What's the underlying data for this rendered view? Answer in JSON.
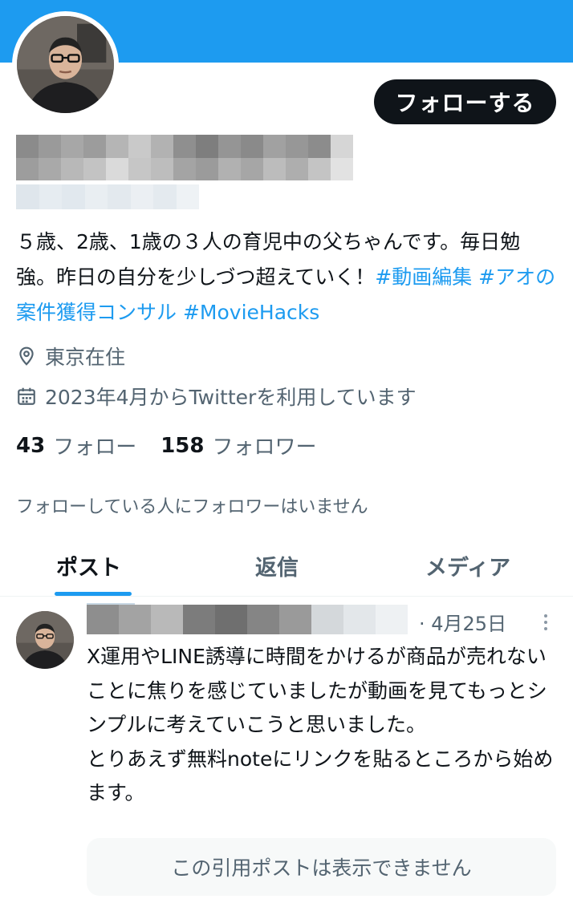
{
  "header": {
    "banner_color": "#1d9bf0",
    "follow_button": "フォローする"
  },
  "profile": {
    "bio_text": "５歳、2歳、1歳の３人の育児中の父ちゃんです。毎日勉強。昨日の自分を少しづつ超えていく！",
    "bio_tags": [
      "#動画編集",
      "#アオの案件獲得コンサル",
      "#MovieHacks"
    ],
    "location": "東京在住",
    "joined": "2023年4月からTwitterを利用しています",
    "following_count": "43",
    "following_label": "フォロー",
    "followers_count": "158",
    "followers_label": "フォロワー",
    "mutual_note": "フォローしている人にフォロワーはいません"
  },
  "tabs": [
    {
      "label": "ポスト",
      "active": true
    },
    {
      "label": "返信",
      "active": false
    },
    {
      "label": "メディア",
      "active": false
    }
  ],
  "post": {
    "date": "· 4月25日",
    "text": "X運用やLINE誘導に時間をかけるが商品が売れないことに焦りを感じていましたが動画を見てもっとシンプルに考えていこうと思いました。\nとりあえず無料noteにリンクを貼るところから始めます。",
    "quote_unavailable": "この引用ポストは表示できません"
  },
  "colors": {
    "accent": "#1d9bf0",
    "text_primary": "#0f1419",
    "text_secondary": "#536471"
  }
}
